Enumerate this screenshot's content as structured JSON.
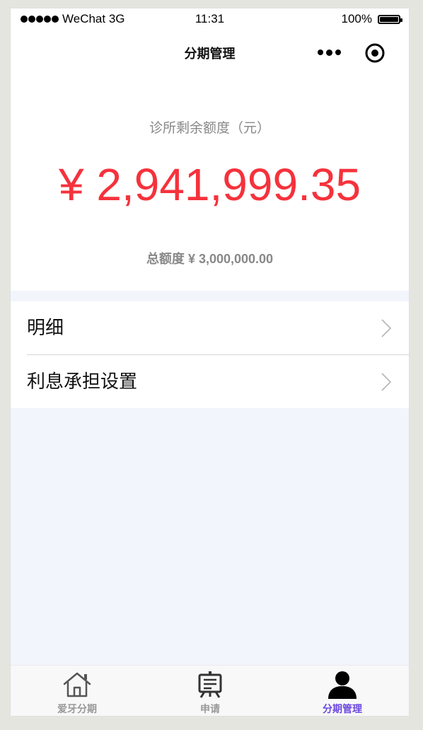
{
  "status_bar": {
    "carrier": "WeChat 3G",
    "time": "11:31",
    "battery": "100%",
    "battery_level": 1.0
  },
  "nav": {
    "title": "分期管理",
    "more_icon": "more-dots-icon",
    "close_icon": "target-circle-icon"
  },
  "balance": {
    "label": "诊所剩余额度（元）",
    "amount": "¥ 2,941,999.35",
    "total": "总额度 ¥ 3,000,000.00",
    "accent_color": "#f5323c"
  },
  "menu": {
    "items": [
      {
        "label": "明细"
      },
      {
        "label": "利息承担设置"
      }
    ]
  },
  "tabs": [
    {
      "label": "爱牙分期",
      "icon": "house-icon",
      "active": false
    },
    {
      "label": "申请",
      "icon": "presentation-board-icon",
      "active": false
    },
    {
      "label": "分期管理",
      "icon": "person-icon",
      "active": true
    }
  ],
  "colors": {
    "active_tab": "#6d48e0",
    "inactive_tab": "#999999",
    "page_bg": "#f3f5fd"
  }
}
